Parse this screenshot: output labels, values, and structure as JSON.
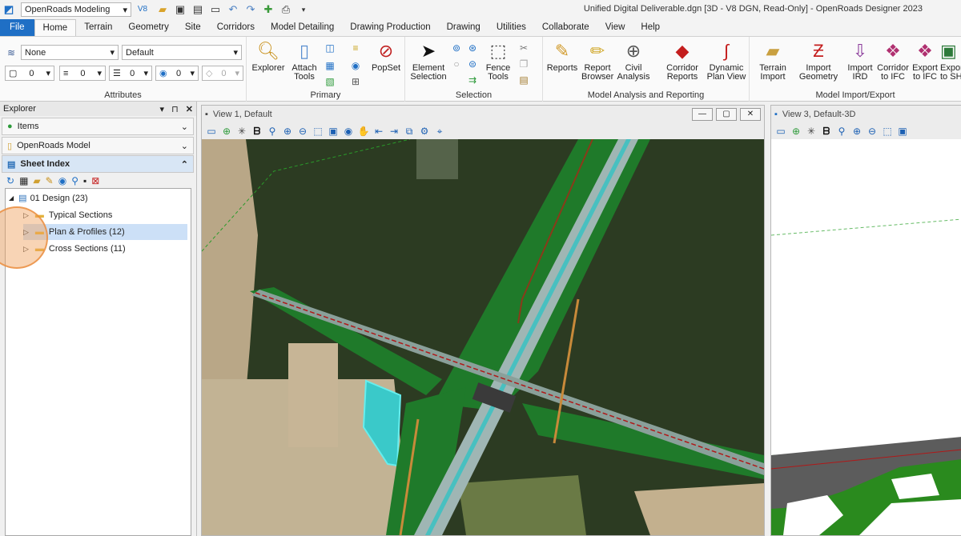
{
  "titlebar": {
    "workflow": "OpenRoads Modeling",
    "title": "Unified Digital Deliverable.dgn [3D - V8 DGN, Read-Only] - OpenRoads Designer 2023",
    "v8": "V8"
  },
  "tabs": [
    "File",
    "Home",
    "Terrain",
    "Geometry",
    "Site",
    "Corridors",
    "Model Detailing",
    "Drawing Production",
    "Drawing",
    "Utilities",
    "Collaborate",
    "View",
    "Help"
  ],
  "ribbon": {
    "attributes": {
      "level": "None",
      "style": "Default",
      "color": "0",
      "weight": "0",
      "linestyle": "0",
      "transparency": "0",
      "priority": "0",
      "label": "Attributes"
    },
    "primary": {
      "explorer": "Explorer",
      "attach_tools": "Attach Tools",
      "popset": "PopSet",
      "label": "Primary"
    },
    "selection": {
      "element_selection": "Element Selection",
      "fence_tools": "Fence Tools",
      "label": "Selection"
    },
    "analysis": {
      "reports": "Reports",
      "report_browser": "Report Browser",
      "civil_analysis": "Civil Analysis",
      "corridor_reports": "Corridor Reports",
      "dynamic_plan_view": "Dynamic Plan View",
      "label": "Model Analysis and Reporting"
    },
    "importexport": {
      "terrain_import": "Terrain Import",
      "import_geometry": "Import Geometry",
      "import_ird": "Import IRD",
      "corridor_to_ifc": "Corridor to IFC",
      "export_to_ifc": "Export to IFC",
      "export_to_sh": "Export to SH",
      "label": "Model Import/Export"
    }
  },
  "explorer": {
    "title": "Explorer",
    "sections": {
      "items": "Items",
      "model": "OpenRoads Model",
      "sheet_index": "Sheet Index"
    },
    "tree": {
      "root": "01 Design (23)",
      "children": [
        "Typical Sections",
        "Plan & Profiles (12)",
        "Cross Sections (11)"
      ]
    }
  },
  "views": {
    "view1": "View 1, Default",
    "view3": "View 3, Default-3D"
  }
}
